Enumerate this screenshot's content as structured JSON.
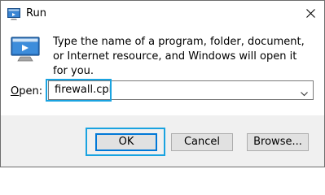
{
  "window": {
    "title": "Run"
  },
  "description": "Type the name of a program, folder, document, or Internet resource, and Windows will open it for you.",
  "open_field": {
    "label_prefix": "",
    "label_underlined": "O",
    "label_suffix": "pen:",
    "value": "firewall.cpl"
  },
  "buttons": {
    "ok": "OK",
    "cancel": "Cancel",
    "browse": "Browse..."
  },
  "colors": {
    "highlight": "#1aa3e0",
    "ok_border": "#0078d7",
    "footer_bg": "#f0f0f0"
  },
  "icons": {
    "title": "run-app-icon",
    "close": "close-icon",
    "body": "run-app-icon-large",
    "dropdown": "chevron-down-icon"
  }
}
